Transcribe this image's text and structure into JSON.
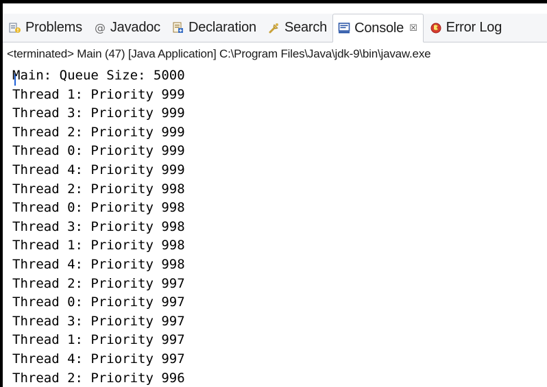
{
  "tabs": [
    {
      "label": "Problems",
      "icon": "problems-icon"
    },
    {
      "label": "Javadoc",
      "icon": "javadoc-icon"
    },
    {
      "label": "Declaration",
      "icon": "declaration-icon"
    },
    {
      "label": "Search",
      "icon": "search-icon"
    },
    {
      "label": "Console",
      "icon": "console-icon",
      "active": true,
      "close": "☒"
    },
    {
      "label": "Error Log",
      "icon": "error-log-icon"
    }
  ],
  "console": {
    "status": "<terminated> Main (47) [Java Application] C:\\Program Files\\Java\\jdk-9\\bin\\javaw.exe",
    "lines": [
      "Main: Queue Size: 5000",
      "Thread 1: Priority 999",
      "Thread 3: Priority 999",
      "Thread 2: Priority 999",
      "Thread 0: Priority 999",
      "Thread 4: Priority 999",
      "Thread 2: Priority 998",
      "Thread 0: Priority 998",
      "Thread 3: Priority 998",
      "Thread 1: Priority 998",
      "Thread 4: Priority 998",
      "Thread 2: Priority 997",
      "Thread 0: Priority 997",
      "Thread 3: Priority 997",
      "Thread 1: Priority 997",
      "Thread 4: Priority 997",
      "Thread 2: Priority 996"
    ]
  },
  "colors": {
    "tabbar_bg": "#f5f6f8",
    "caret": "#1e5fd8"
  }
}
